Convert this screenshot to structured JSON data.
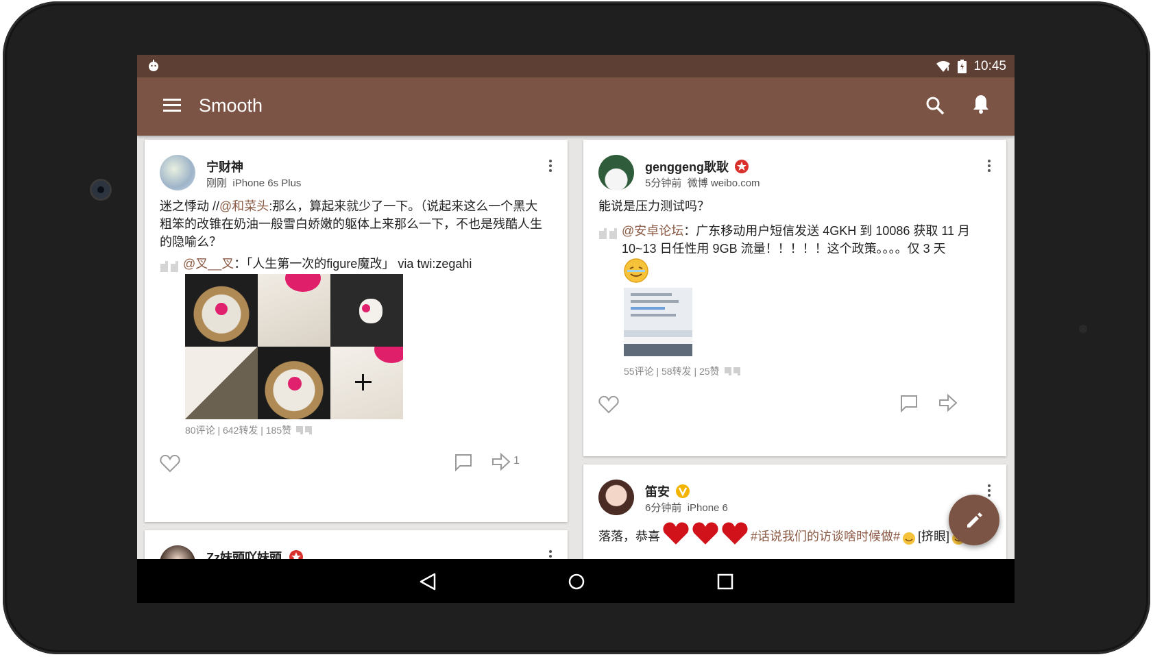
{
  "status": {
    "time": "10:45"
  },
  "toolbar": {
    "title": "Smooth"
  },
  "posts": [
    {
      "username": "宁财神",
      "time": "刚刚",
      "source": "iPhone 6s Plus",
      "text_prefix": "迷之悸动 //",
      "mention": "@和菜头",
      "text_line1_rest": ":那么，算起来就少了一下。（说起来这么一个黑大",
      "text_line2": "粗笨的改锥在奶油一般雪白娇嫩的躯体上来那么一下，不也是残酷人生",
      "text_line3": "的隐喻么？",
      "repost_mention": "@叉__叉",
      "repost_text": "：「人生第一次的figure魔改」 via twi:zegahi",
      "repost_stats": "80评论 | 642转发 | 185赞",
      "share_count": "1"
    },
    {
      "username": "genggeng耿耿",
      "time": "5分钟前",
      "source": "微博 weibo.com",
      "text": "能说是压力测试吗？",
      "repost_mention": "@安卓论坛",
      "repost_line1": "：广东移动用户短信发送 4GKH 到 10086 获取 11 月",
      "repost_line2": "10~13 日任性用 9GB 流量！！！！！这个政策。。。。仅 3 天",
      "repost_stats": "55评论 | 58转发 | 25赞"
    },
    {
      "username": "笛安",
      "time": "6分钟前",
      "source": "iPhone 6",
      "text_prefix": "落落，恭喜",
      "hashtag": "#话说我们的访谈啥时候做#",
      "text_suffix": "[挤眼]"
    },
    {
      "username": "Zz妹頭吖妹頭"
    }
  ],
  "colors": {
    "accent": "#7b5445",
    "statusbar": "#5d3f33",
    "mention": "#8b5a44",
    "verified_red": "#d9322c",
    "verified_gold": "#f2b400"
  },
  "icons": [
    "menu-icon",
    "search-icon",
    "bell-icon",
    "more-icon",
    "like-icon",
    "comment-icon",
    "share-icon",
    "edit-icon"
  ]
}
